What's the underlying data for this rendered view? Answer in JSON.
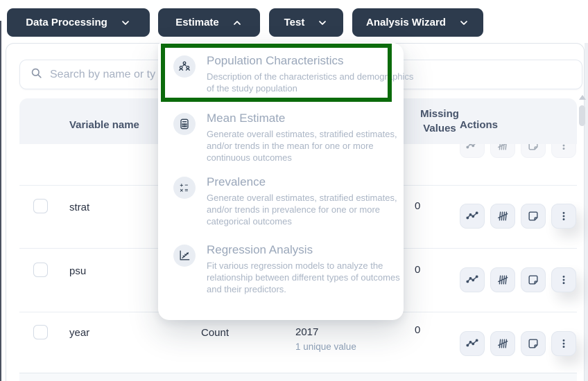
{
  "colors": {
    "nav_bg": "#2d3b4d",
    "accent_green": "#0b6b0b",
    "header_bg": "#f2f4f8"
  },
  "nav": {
    "items": [
      {
        "label": "Data Processing",
        "state": "collapsed"
      },
      {
        "label": "Estimate",
        "state": "expanded"
      },
      {
        "label": "Test",
        "state": "collapsed"
      },
      {
        "label": "Analysis Wizard",
        "state": "collapsed"
      }
    ]
  },
  "search": {
    "placeholder": "Search by name or ty"
  },
  "menu": {
    "items": [
      {
        "icon": "people-group-icon",
        "title": "Population Characteristics",
        "description": "Description of the characteristics and demographics of the study population",
        "highlighted": true
      },
      {
        "icon": "calculator-icon",
        "title": "Mean Estimate",
        "description": "Generate overall estimates, stratified estimates, and/or trends in the mean for one or more continuous outcomes",
        "highlighted": false
      },
      {
        "icon": "math-operators-icon",
        "title": "Prevalence",
        "description": "Generate overall estimates, stratified estimates, and/or trends in prevalence for one or more categorical outcomes",
        "highlighted": false
      },
      {
        "icon": "regression-chart-icon",
        "title": "Regression Analysis",
        "description": "Fit various regression models to analyze the relationship between different types of outcomes and their predictors.",
        "highlighted": false
      }
    ]
  },
  "table": {
    "headers": {
      "variable_name": "Variable name",
      "missing_lines": [
        "Missing",
        "Values"
      ],
      "actions": "Actions"
    },
    "action_icons": [
      "trend-chart",
      "histogram",
      "note",
      "more"
    ],
    "rows": [
      {
        "name": "strat",
        "type": "",
        "value": "",
        "note": "",
        "missing": "0"
      },
      {
        "name": "psu",
        "type": "",
        "value": "",
        "note": "",
        "missing": "0"
      },
      {
        "name": "year",
        "type": "Count",
        "value": "2017",
        "note": "1 unique value",
        "missing": "0"
      }
    ]
  }
}
